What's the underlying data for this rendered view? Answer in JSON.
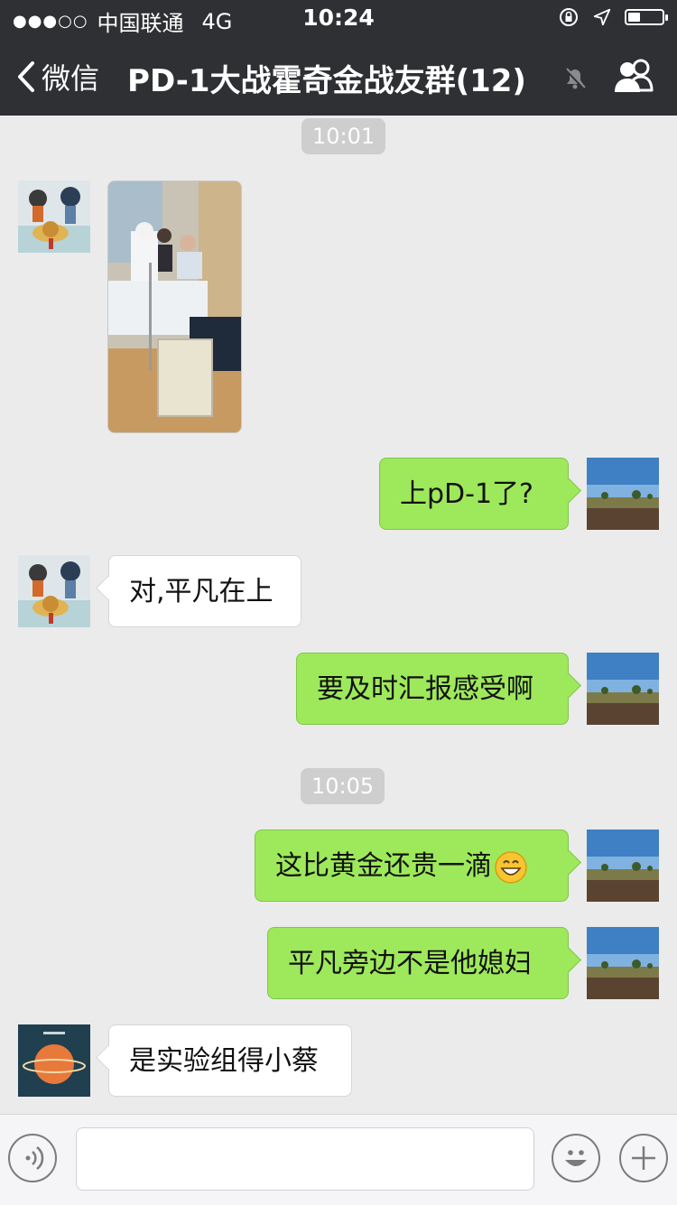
{
  "status_bar": {
    "signal": "●●●○○",
    "carrier": "中国联通",
    "network": "4G",
    "time": "10:24",
    "battery_level": 0.35,
    "icons": [
      "orientation-lock-icon",
      "location-arrow-icon",
      "battery-icon"
    ]
  },
  "nav": {
    "back_label": "微信",
    "title": "PD-1大战霍奇金战友群(12)",
    "icons": [
      "chevron-left-icon",
      "mute-bell-icon",
      "group-members-icon"
    ]
  },
  "chat": {
    "time_labels": [
      "10:01",
      "10:05"
    ],
    "messages": [
      {
        "side": "in",
        "avatar": "cartoon-kids-avatar",
        "type": "image",
        "content": "hospital-room-photo"
      },
      {
        "side": "out",
        "avatar": "landscape-avatar",
        "type": "text",
        "text": "上pD-1了?"
      },
      {
        "side": "in",
        "avatar": "cartoon-kids-avatar",
        "type": "text",
        "text": "对,平凡在上"
      },
      {
        "side": "out",
        "avatar": "landscape-avatar",
        "type": "text",
        "text": "要及时汇报感受啊"
      },
      {
        "side": "out",
        "avatar": "landscape-avatar",
        "type": "text",
        "text": "这比黄金还贵一滴",
        "emoji": "grinning-face"
      },
      {
        "side": "out",
        "avatar": "landscape-avatar",
        "type": "text",
        "text": "平凡旁边不是他媳妇"
      },
      {
        "side": "in",
        "avatar": "orange-planet-avatar",
        "type": "text",
        "text": "是实验组得小蔡"
      }
    ]
  },
  "input_bar": {
    "icons": [
      "voice-icon",
      "emoji-icon",
      "plus-icon"
    ],
    "text": ""
  },
  "colors": {
    "nav_bg": "#2f3033",
    "chat_bg": "#ebebeb",
    "out_bubble": "#9ee95b",
    "in_bubble": "#ffffff",
    "time_label_bg": "#cecece"
  }
}
